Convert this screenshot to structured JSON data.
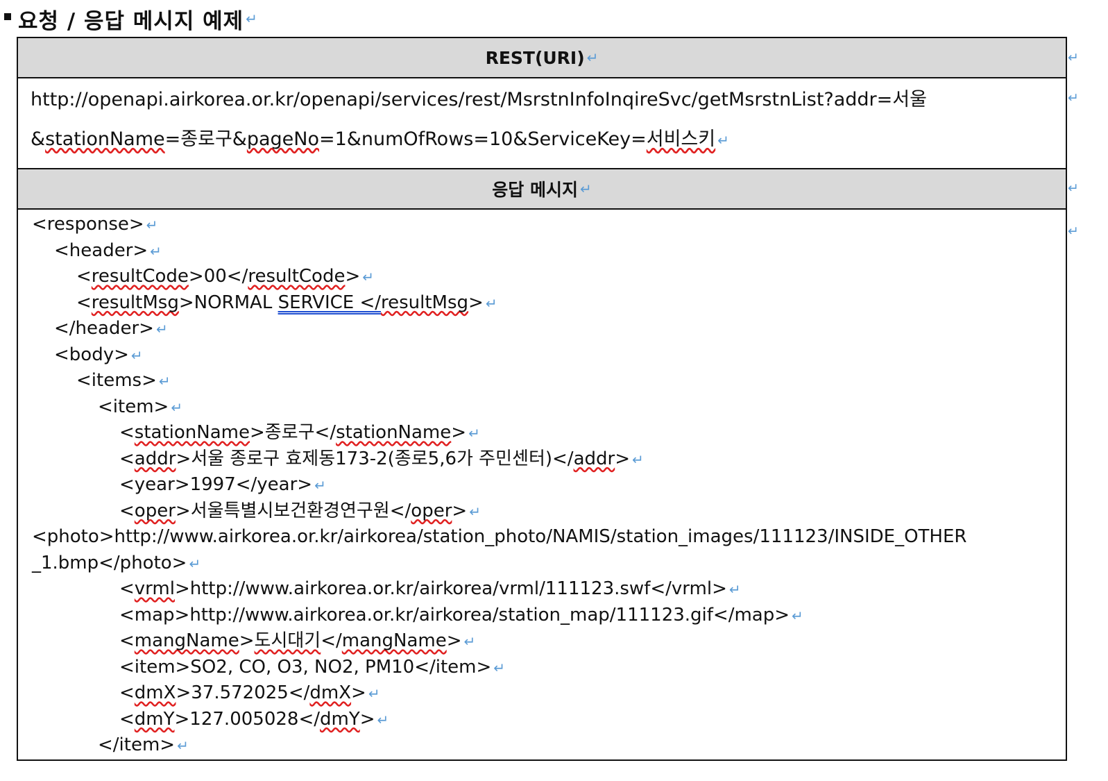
{
  "heading": {
    "title": "요청 / 응답 메시지 예제"
  },
  "return_mark": "↵",
  "table": {
    "rest_header": "REST(URI)",
    "uri": {
      "line1": "http://openapi.airkorea.or.kr/openapi/services/rest/MsrstnInfoInqireSvc/getMsrstnList?addr=서울",
      "line2": {
        "p1": "&",
        "p2": "stationName",
        "p3": "=종로구&",
        "p4": "pageNo",
        "p5": "=1&numOfRows=10&ServiceKey=",
        "p6": "서비스키"
      }
    },
    "response_header": "응답 메시지",
    "response": {
      "response_open": "<response>",
      "header_open": "<header>",
      "result_code": {
        "a": "<",
        "b": "resultCode",
        "c": ">00</",
        "d": "resultCode",
        "e": ">"
      },
      "result_msg": {
        "a": "<",
        "b": "resultMsg",
        "c": ">NORMAL ",
        "d": "SERVICE </",
        "e": "resultMsg",
        "f": ">"
      },
      "header_close": "</header>",
      "body_open": "<body>",
      "items_open": "<items>",
      "item_open": "<item>",
      "station_name": {
        "a": "<",
        "b": "stationName",
        "c": ">종로구</",
        "d": "stationName",
        "e": ">"
      },
      "addr": {
        "a": "<",
        "b": "addr",
        "c": ">서울 종로구 효제동173-2(종로5,6가 주민센터)</",
        "d": "addr",
        "e": ">"
      },
      "year": "<year>1997</year>",
      "oper": {
        "a": "<",
        "b": "oper",
        "c": ">서울특별시보건환경연구원</",
        "d": "oper",
        "e": ">"
      },
      "photo_line1": "<photo>http://www.airkorea.or.kr/airkorea/station_photo/NAMIS/station_images/111123/INSIDE_OTHER",
      "photo_line2": "_1.bmp</photo>",
      "vrml": {
        "a": "<",
        "b": "vrml",
        "c": ">http://www.airkorea.or.kr/airkorea/vrml/111123.swf</vrml>"
      },
      "map": "<map>http://www.airkorea.or.kr/airkorea/station_map/111123.gif</map>",
      "mang_name": {
        "a": "<",
        "b": "mangName",
        "c": ">",
        "d": "도시대기",
        "e": "</",
        "f": "mangName",
        "g": ">"
      },
      "item_list": "<item>SO2, CO, O3, NO2, PM10</item>",
      "dmx": {
        "a": "<",
        "b": "dmX",
        "c": ">37.572025</",
        "d": "dmX",
        "e": ">"
      },
      "dmy": {
        "a": "<",
        "b": "dmY",
        "c": ">127.005028</",
        "d": "dmY",
        "e": ">"
      },
      "item_close": "</item>"
    }
  }
}
